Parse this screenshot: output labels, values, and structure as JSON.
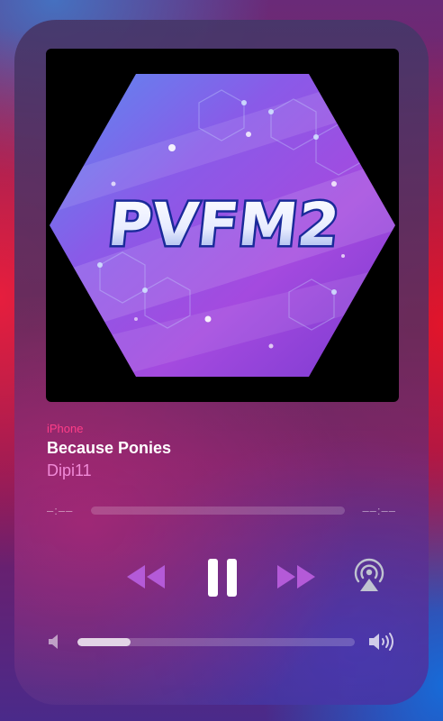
{
  "artwork": {
    "text": "PVFM2"
  },
  "now_playing": {
    "device": "iPhone",
    "title": "Because Ponies",
    "artist": "Dipi11"
  },
  "progress": {
    "elapsed": "–:––",
    "remaining": "––:––"
  },
  "controls": {
    "rewind_icon": "rewind-icon",
    "pause_icon": "pause-icon",
    "forward_icon": "fast-forward-icon",
    "airplay_icon": "airplay-audio-icon"
  },
  "volume": {
    "level": 0.19,
    "low_icon": "speaker-low-icon",
    "high_icon": "speaker-high-icon"
  },
  "colors": {
    "device": "#ff3e88",
    "artist": "#f08ad8",
    "title": "#ffffff"
  }
}
